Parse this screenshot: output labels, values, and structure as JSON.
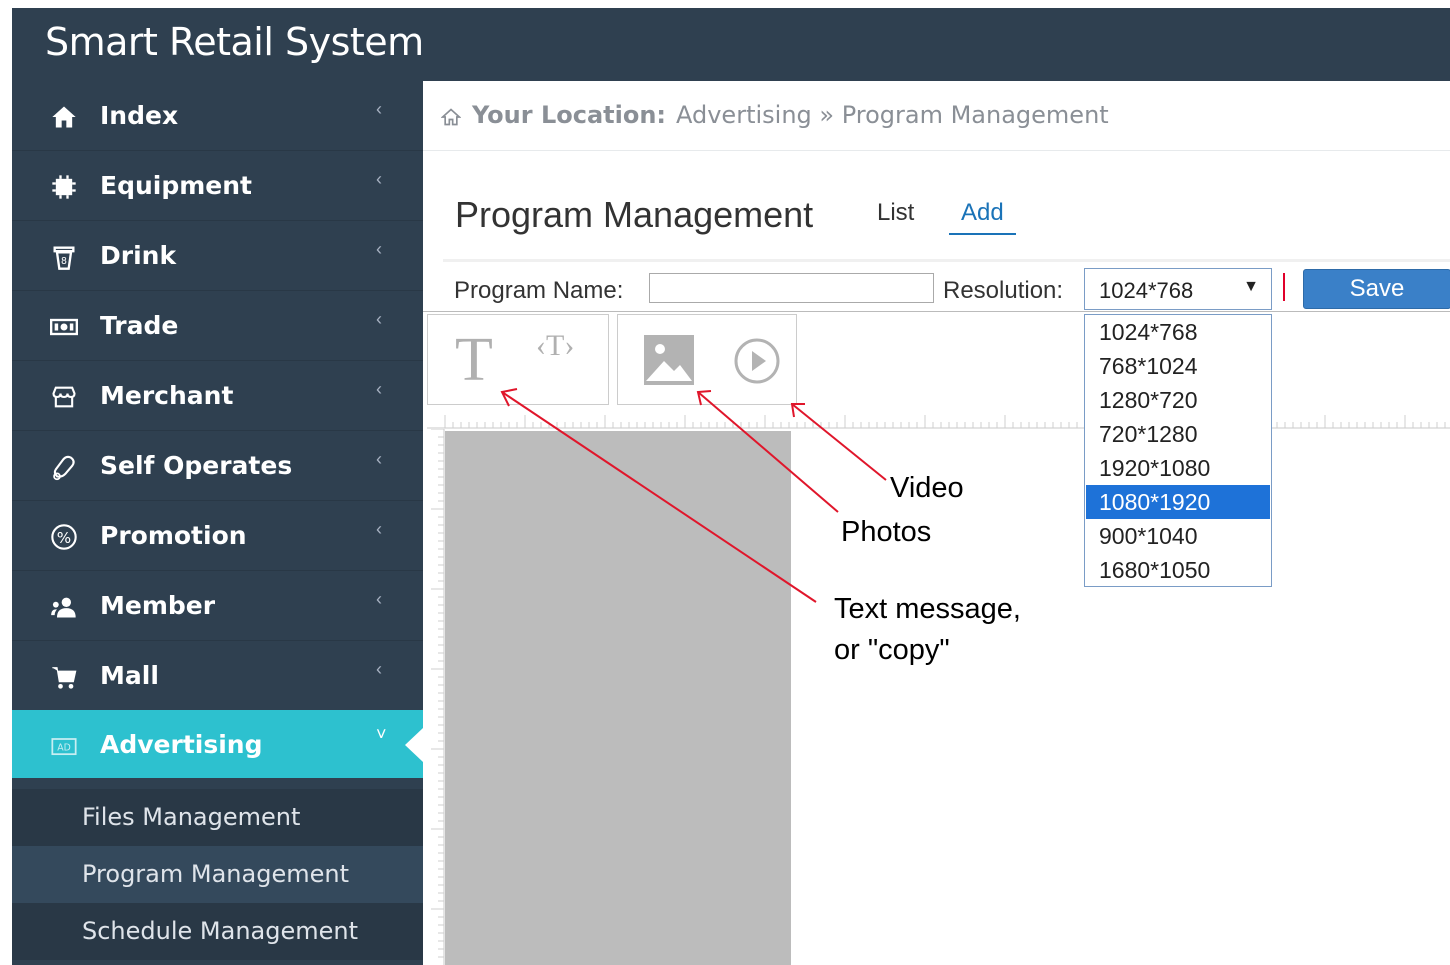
{
  "app": {
    "title": "Smart Retail System"
  },
  "sidebar": {
    "items": [
      {
        "label": "Index",
        "icon": "home-icon",
        "chevron": "‹"
      },
      {
        "label": "Equipment",
        "icon": "chip-icon",
        "chevron": "‹"
      },
      {
        "label": "Drink",
        "icon": "cup-icon",
        "chevron": "‹"
      },
      {
        "label": "Trade",
        "icon": "money-icon",
        "chevron": "‹"
      },
      {
        "label": "Merchant",
        "icon": "store-icon",
        "chevron": "‹"
      },
      {
        "label": "Self Operates",
        "icon": "hand-icon",
        "chevron": "‹"
      },
      {
        "label": "Promotion",
        "icon": "percent-icon",
        "chevron": "‹"
      },
      {
        "label": "Member",
        "icon": "users-icon",
        "chevron": "‹"
      },
      {
        "label": "Mall",
        "icon": "cart-icon",
        "chevron": "‹"
      },
      {
        "label": "Advertising",
        "icon": "ad-icon",
        "chevron": "˅",
        "active": true
      }
    ],
    "subitems": [
      {
        "label": "Files Management"
      },
      {
        "label": "Program Management",
        "selected": true
      },
      {
        "label": "Schedule Management"
      }
    ]
  },
  "breadcrumb": {
    "label": "Your Location:",
    "path": "Advertising » Program Management"
  },
  "page": {
    "title": "Program Management",
    "tabs": [
      {
        "label": "List"
      },
      {
        "label": "Add",
        "active": true
      }
    ]
  },
  "form": {
    "program_name_label": "Program Name:",
    "program_name_value": "",
    "resolution_label": "Resolution:",
    "resolution_value": "1024*768",
    "resolution_options": [
      "1024*768",
      "768*1024",
      "1280*720",
      "720*1280",
      "1920*1080",
      "1080*1920",
      "900*1040",
      "1680*1050"
    ],
    "highlighted_option": "1080*1920",
    "save_label": "Save"
  },
  "tools": {
    "text": "T",
    "text_tag": "‹T›"
  },
  "annotations": {
    "video": "Video",
    "photos": "Photos",
    "text_line1": "Text message,",
    "text_line2": "or \"copy\""
  },
  "colors": {
    "sidebar_bg": "#2f4050",
    "active_bg": "#2dc1cf",
    "save_bg": "#3a80c8",
    "option_highlight": "#1e72d8",
    "annotation_arrow": "#e0162b"
  }
}
